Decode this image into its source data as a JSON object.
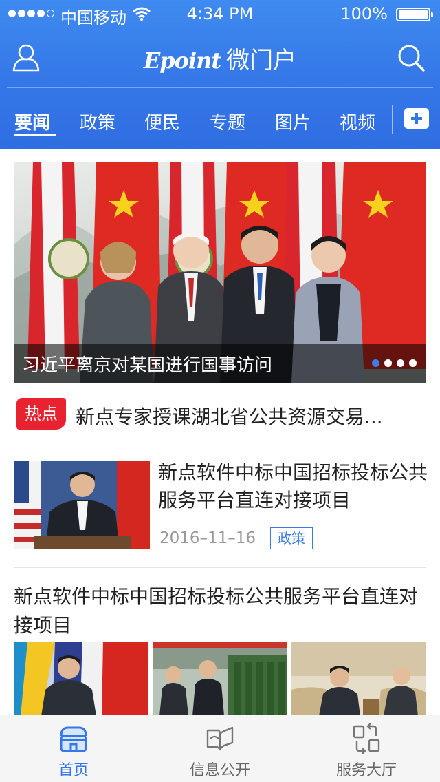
{
  "status_bar": {
    "carrier": "中国移动",
    "time": "4:34 PM",
    "battery": "100%"
  },
  "header": {
    "logo_text": "Epoint",
    "app_name": "微门户"
  },
  "tabs": [
    {
      "label": "要闻",
      "active": true
    },
    {
      "label": "政策",
      "active": false
    },
    {
      "label": "便民",
      "active": false
    },
    {
      "label": "专题",
      "active": false
    },
    {
      "label": "图片",
      "active": false
    },
    {
      "label": "视频",
      "active": false
    }
  ],
  "banner": {
    "caption": "习近平离京对某国进行国事访问",
    "slides": 4,
    "active_slide": 1
  },
  "hot": {
    "badge": "热点",
    "text": "新点专家授课湖北省公共资源交易..."
  },
  "news_item": {
    "title": "新点软件中标中国招标投标公共服务平台直连对接项目",
    "date": "2016–11–16",
    "tag": "政策"
  },
  "gallery_item": {
    "title": "新点软件中标中国招标投标公共服务平台直连对接项目"
  },
  "tabbar": [
    {
      "label": "首页",
      "icon": "home-icon",
      "active": true
    },
    {
      "label": "信息公开",
      "icon": "open-book-icon",
      "active": false
    },
    {
      "label": "服务大厅",
      "icon": "service-hall-icon",
      "active": false
    }
  ],
  "colors": {
    "primary": "#3577e8",
    "hot_badge": "#e8232f",
    "tab_text_inactive": "#666666"
  }
}
